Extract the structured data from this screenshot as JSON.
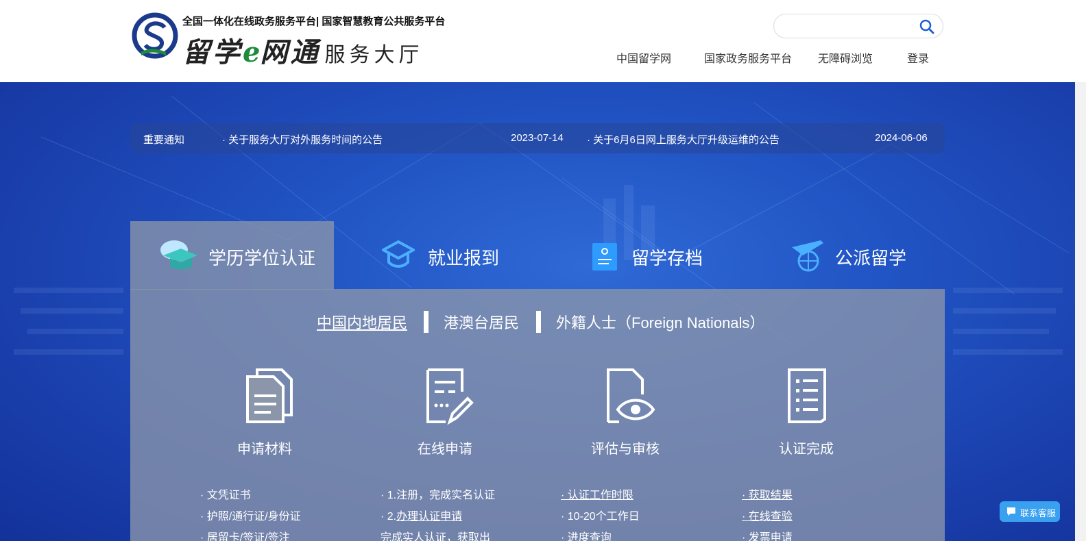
{
  "header": {
    "top_line": "全国一体化在线政务服务平台| 国家智慧教育公共服务平台",
    "brand_main": "留学",
    "brand_e": "e",
    "brand_net": "网通",
    "brand_hall": "服务大厅",
    "search_placeholder": "",
    "nav": [
      "中国留学网",
      "国家政务服务平台",
      "无障碍浏览",
      "登录"
    ]
  },
  "notice": {
    "label": "重要通知",
    "items": [
      {
        "title": "· 关于服务大厅对外服务时间的公告",
        "date": "2023-07-14"
      },
      {
        "title": "· 关于6月6日网上服务大厅升级运维的公告",
        "date": "2024-06-06"
      }
    ]
  },
  "tabs": [
    "学历学位认证",
    "就业报到",
    "留学存档",
    "公派留学"
  ],
  "subtabs": [
    "中国内地居民",
    "港澳台居民",
    "外籍人士（Foreign Nationals）"
  ],
  "steps": [
    {
      "title": "申请材料",
      "items": [
        "· 文凭证书",
        "· 护照/通行证/身份证",
        "· 居留卡/签证/签注"
      ]
    },
    {
      "title": "在线申请",
      "items": [
        "· 1.注册，完成实名认证",
        "· 2.办理认证申请",
        "  完成实人认证，获取出"
      ],
      "link_label": "办理认证申请"
    },
    {
      "title": "评估与审核",
      "items": [
        "· 认证工作时限",
        "· 10-20个工作日",
        "· 进度查询"
      ]
    },
    {
      "title": "认证完成",
      "items": [
        "· 获取结果",
        "· 在线查验",
        "· 发票申请"
      ]
    }
  ],
  "customer_service": "联系客服",
  "colors": {
    "accent": "#2154c4",
    "panel": "#8c96aa",
    "cs_button": "#3aa0f0"
  }
}
